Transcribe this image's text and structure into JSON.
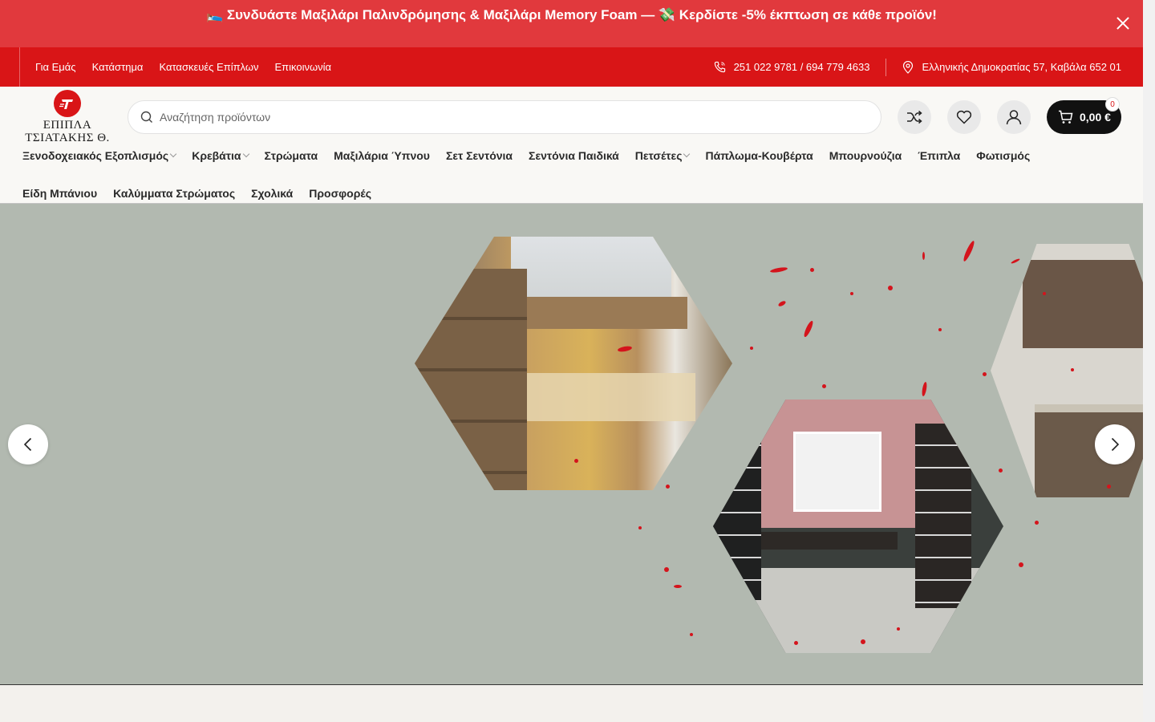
{
  "promo": {
    "text": "🛌 Συνδυάστε Μαξιλάρι Παλινδρόμησης & Μαξιλάρι Memory Foam — 💸 Κερδίστε -5% έκπτωση σε κάθε προϊόν!",
    "close_icon": "close-icon"
  },
  "topbar": {
    "links": [
      "Για Εμάς",
      "Κατάστημα",
      "Κατασκευές Επίπλων",
      "Επικοινωνία"
    ],
    "phone": "251 022 9781 / 694 779 4633",
    "address": "Ελληνικής Δημοκρατίας 57, Καβάλα 652 01"
  },
  "logo": {
    "line1": "ΕΠΙΠΛΑ",
    "line2": "ΤΣΙΑΤΑΚΗΣ Θ."
  },
  "search": {
    "placeholder": "Αναζήτηση προϊόντων"
  },
  "cart": {
    "total": "0,00 €",
    "count": "0"
  },
  "nav": {
    "row1": [
      {
        "label": "Ξενοδοχειακός Εξοπλισμός",
        "has_dropdown": true
      },
      {
        "label": "Κρεβάτια",
        "has_dropdown": true
      },
      {
        "label": "Στρώματα",
        "has_dropdown": false
      },
      {
        "label": "Μαξιλάρια Ύπνου",
        "has_dropdown": false
      },
      {
        "label": "Σετ Σεντόνια",
        "has_dropdown": false
      },
      {
        "label": "Σεντόνια Παιδικά",
        "has_dropdown": false
      },
      {
        "label": "Πετσέτες",
        "has_dropdown": true
      },
      {
        "label": "Πάπλωμα-Κουβέρτα",
        "has_dropdown": false
      },
      {
        "label": "Μπουρνούζια",
        "has_dropdown": false
      },
      {
        "label": "Έπιπλα",
        "has_dropdown": false
      },
      {
        "label": "Φωτισμός",
        "has_dropdown": false
      }
    ],
    "row2": [
      {
        "label": "Είδη Μπάνιου",
        "has_dropdown": false
      },
      {
        "label": "Καλύμματα Στρώματος",
        "has_dropdown": false
      },
      {
        "label": "Σχολικά",
        "has_dropdown": false
      },
      {
        "label": "Προσφορές",
        "has_dropdown": false
      }
    ]
  },
  "colors": {
    "promo_bg": "#e1393d",
    "topbar_bg": "#d91517",
    "hero_bg": "#b2b9b0",
    "cart_bg": "#111111"
  }
}
